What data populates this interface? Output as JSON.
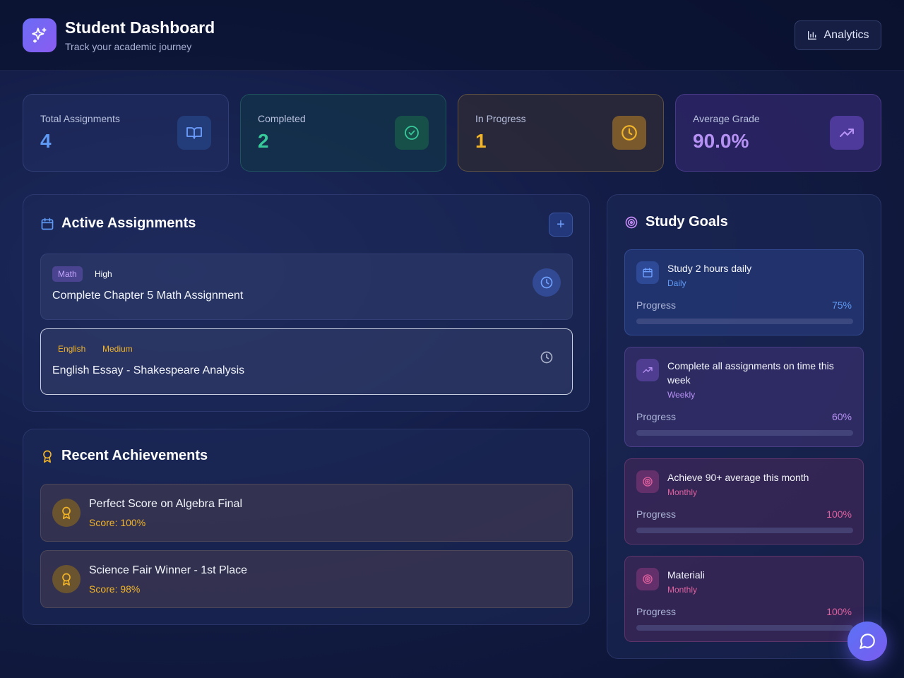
{
  "header": {
    "title": "Student Dashboard",
    "subtitle": "Track your academic journey",
    "analytics_label": "Analytics"
  },
  "stats": [
    {
      "label": "Total Assignments",
      "value": "4",
      "icon": "book-open-icon",
      "color": "#5f9af5"
    },
    {
      "label": "Completed",
      "value": "2",
      "icon": "check-circle-icon",
      "color": "#37c99a"
    },
    {
      "label": "In Progress",
      "value": "1",
      "icon": "clock-icon",
      "color": "#f2b529"
    },
    {
      "label": "Average Grade",
      "value": "90.0%",
      "icon": "trending-up-icon",
      "color": "#b792f5"
    }
  ],
  "assignments": {
    "title": "Active Assignments",
    "add_label": "+",
    "items": [
      {
        "subject": "Math",
        "priority": "High",
        "title": "Complete Chapter 5 Math Assignment"
      },
      {
        "subject": "English",
        "priority": "Medium",
        "title": "English Essay - Shakespeare Analysis"
      }
    ]
  },
  "achievements": {
    "title": "Recent Achievements",
    "items": [
      {
        "title": "Perfect Score on Algebra Final",
        "score": "Score: 100%"
      },
      {
        "title": "Science Fair Winner - 1st Place",
        "score": "Score: 98%"
      }
    ]
  },
  "goals": {
    "title": "Study Goals",
    "progress_label": "Progress",
    "items": [
      {
        "name": "Study 2 hours daily",
        "frequency": "Daily",
        "progress": 0.75,
        "progress_text": "75%",
        "color": "#5f9af5"
      },
      {
        "name": "Complete all assignments on time this week",
        "frequency": "Weekly",
        "progress": 0.6,
        "progress_text": "60%",
        "color": "#b792f5"
      },
      {
        "name": "Achieve 90+ average this month",
        "frequency": "Monthly",
        "progress": 1.0,
        "progress_text": "100%",
        "color": "#e0609e"
      },
      {
        "name": "Materiali",
        "frequency": "Monthly",
        "progress": 1.0,
        "progress_text": "100%",
        "color": "#e0609e"
      }
    ]
  }
}
